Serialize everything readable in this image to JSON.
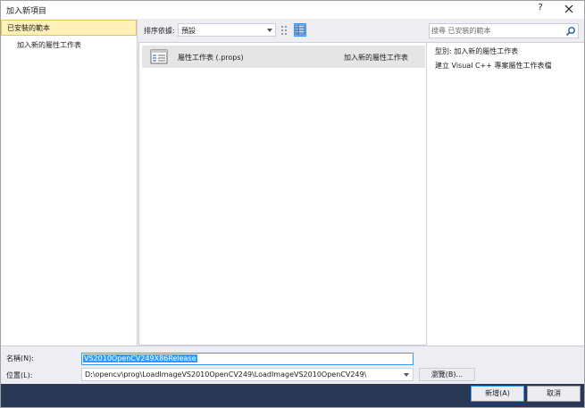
{
  "window": {
    "title": "加入新項目",
    "help_label": "?"
  },
  "left_pane": {
    "installed_label": "已安裝的範本",
    "items": [
      {
        "label": "加入新的屬性工作表"
      }
    ]
  },
  "sortbar": {
    "sort_label": "排序依據:",
    "sort_value": "預設"
  },
  "search": {
    "placeholder": "搜尋 已安裝的範本"
  },
  "templates": [
    {
      "name": "屬性工作表 (.props)",
      "category": "加入新的屬性工作表",
      "icon": "property-sheet-icon"
    }
  ],
  "details": {
    "type_line": "型別:  加入新的屬性工作表",
    "description": "建立 Visual C++ 專案屬性工作表檔"
  },
  "form": {
    "name_label": "名稱(N):",
    "name_value": "VS2010OpenCV249X86Release",
    "location_label": "位置(L):",
    "location_value": "D:\\opencv\\prog\\LoadImageVS2010OpenCV249\\LoadImageVS2010OpenCV249\\",
    "browse_label": "瀏覽(B)..."
  },
  "footer": {
    "ok_label": "新增(A)",
    "cancel_label": "取消"
  },
  "colors": {
    "accent": "#3399ff",
    "footer_bg": "#293955",
    "selected_header": "#fff1b8"
  }
}
